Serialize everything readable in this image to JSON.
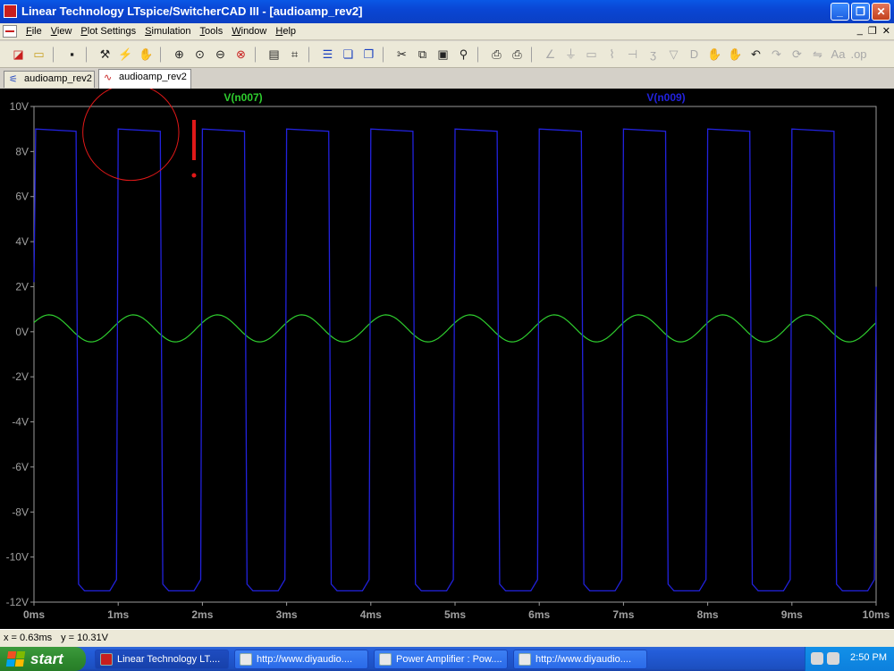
{
  "window": {
    "title": "Linear Technology LTspice/SwitcherCAD III - [audioamp_rev2]",
    "buttons": [
      "_",
      "❐",
      "✕"
    ]
  },
  "menubar": {
    "items": [
      "File",
      "View",
      "Plot Settings",
      "Simulation",
      "Tools",
      "Window",
      "Help"
    ],
    "mdi_buttons": [
      "_",
      "❐",
      "✕"
    ]
  },
  "toolbar": {
    "icons": [
      "new-schematic-icon",
      "open-icon",
      "save-icon",
      "control-panel-icon",
      "run-icon",
      "halt-icon",
      "zoom-in-icon",
      "zoom-extent-icon",
      "zoom-out-icon",
      "cancel-zoom-icon",
      "autorange-icon",
      "pick-visible-traces-icon",
      "tile-horizontal-icon",
      "cascade-icon",
      "tile-vertical-icon",
      "cut-icon",
      "copy-icon",
      "paste-icon",
      "find-icon",
      "print-setup-icon",
      "print-icon",
      "wire-icon",
      "ground-icon",
      "label-icon",
      "resistor-icon",
      "capacitor-icon",
      "inductor-icon",
      "diode-icon",
      "component-icon",
      "move-icon",
      "drag-icon",
      "undo-icon",
      "redo-icon",
      "rotate-icon",
      "mirror-icon",
      "text-icon",
      "spice-directive-icon"
    ]
  },
  "tabs": [
    {
      "label": "audioamp_rev2",
      "icon": "schematic-icon"
    },
    {
      "label": "audioamp_rev2",
      "icon": "waveform-icon"
    }
  ],
  "statusbar": {
    "x": "x = 0.63ms",
    "y": "y = 10.31V"
  },
  "taskbar": {
    "start": "start",
    "tasks": [
      "Linear Technology LT....",
      "http://www.diyaudio....",
      "Power Amplifier : Pow....",
      "http://www.diyaudio...."
    ],
    "clock": "2:50 PM"
  },
  "colors": {
    "green_trace": "#2ecc2e",
    "blue_trace": "#2222dd",
    "annotation": "#e01818"
  },
  "chart_data": {
    "type": "line",
    "xlim": [
      0,
      10
    ],
    "ylim": [
      -12,
      10
    ],
    "x_ticks": [
      "0ms",
      "1ms",
      "2ms",
      "3ms",
      "4ms",
      "5ms",
      "6ms",
      "7ms",
      "8ms",
      "9ms",
      "10ms"
    ],
    "y_ticks": [
      "10V",
      "8V",
      "6V",
      "4V",
      "2V",
      "0V",
      "-2V",
      "-4V",
      "-6V",
      "-8V",
      "-10V",
      "-12V"
    ],
    "series": [
      {
        "name": "V(n007)",
        "color": "#2ecc2e",
        "description_values": {
          "amplitude": 0.6,
          "offset": 0.15,
          "frequency_khz": 1.0,
          "phase_deg": 20
        },
        "points": [
          [
            0.0,
            0.4
          ],
          [
            0.18,
            0.75
          ],
          [
            0.43,
            0.2
          ],
          [
            0.68,
            -0.45
          ],
          [
            0.93,
            0.1
          ],
          [
            1.18,
            0.75
          ],
          [
            1.43,
            0.2
          ],
          [
            1.68,
            -0.45
          ],
          [
            1.93,
            0.1
          ],
          [
            2.18,
            0.75
          ],
          [
            2.43,
            0.2
          ],
          [
            2.68,
            -0.45
          ],
          [
            2.93,
            0.1
          ],
          [
            3.18,
            0.75
          ],
          [
            3.43,
            0.2
          ],
          [
            3.68,
            -0.45
          ],
          [
            3.93,
            0.1
          ],
          [
            4.18,
            0.75
          ],
          [
            4.43,
            0.2
          ],
          [
            4.68,
            -0.45
          ],
          [
            4.93,
            0.1
          ],
          [
            5.18,
            0.75
          ],
          [
            5.43,
            0.2
          ],
          [
            5.68,
            -0.45
          ],
          [
            5.93,
            0.1
          ],
          [
            6.18,
            0.75
          ],
          [
            6.43,
            0.2
          ],
          [
            6.68,
            -0.45
          ],
          [
            6.93,
            0.1
          ],
          [
            7.18,
            0.75
          ],
          [
            7.43,
            0.2
          ],
          [
            7.68,
            -0.45
          ],
          [
            7.93,
            0.1
          ],
          [
            8.18,
            0.75
          ],
          [
            8.43,
            0.2
          ],
          [
            8.68,
            -0.45
          ],
          [
            8.93,
            0.1
          ],
          [
            9.18,
            0.75
          ],
          [
            9.43,
            0.2
          ],
          [
            9.68,
            -0.45
          ],
          [
            9.93,
            0.1
          ],
          [
            10.0,
            0.3
          ]
        ]
      },
      {
        "name": "V(n009)",
        "color": "#2222dd",
        "points": [
          [
            0.0,
            2.2
          ],
          [
            0.02,
            9.0
          ],
          [
            0.5,
            8.9
          ],
          [
            0.53,
            -11.2
          ],
          [
            0.6,
            -11.5
          ],
          [
            0.9,
            -11.5
          ],
          [
            0.98,
            -11.0
          ],
          [
            1.0,
            9.0
          ],
          [
            1.5,
            8.9
          ],
          [
            1.53,
            -11.2
          ],
          [
            1.6,
            -11.5
          ],
          [
            1.9,
            -11.5
          ],
          [
            1.98,
            -11.0
          ],
          [
            2.0,
            9.0
          ],
          [
            2.5,
            8.9
          ],
          [
            2.53,
            -11.2
          ],
          [
            2.6,
            -11.5
          ],
          [
            2.9,
            -11.5
          ],
          [
            2.98,
            -11.0
          ],
          [
            3.0,
            9.0
          ],
          [
            3.5,
            8.9
          ],
          [
            3.53,
            -11.2
          ],
          [
            3.6,
            -11.5
          ],
          [
            3.9,
            -11.5
          ],
          [
            3.98,
            -11.0
          ],
          [
            4.0,
            9.0
          ],
          [
            4.5,
            8.9
          ],
          [
            4.53,
            -11.2
          ],
          [
            4.6,
            -11.5
          ],
          [
            4.9,
            -11.5
          ],
          [
            4.98,
            -11.0
          ],
          [
            5.0,
            9.0
          ],
          [
            5.5,
            8.9
          ],
          [
            5.53,
            -11.2
          ],
          [
            5.6,
            -11.5
          ],
          [
            5.9,
            -11.5
          ],
          [
            5.98,
            -11.0
          ],
          [
            6.0,
            9.0
          ],
          [
            6.5,
            8.9
          ],
          [
            6.53,
            -11.2
          ],
          [
            6.6,
            -11.5
          ],
          [
            6.9,
            -11.5
          ],
          [
            6.98,
            -11.0
          ],
          [
            7.0,
            9.0
          ],
          [
            7.5,
            8.9
          ],
          [
            7.53,
            -11.2
          ],
          [
            7.6,
            -11.5
          ],
          [
            7.9,
            -11.5
          ],
          [
            7.98,
            -11.0
          ],
          [
            8.0,
            9.0
          ],
          [
            8.5,
            8.9
          ],
          [
            8.53,
            -11.2
          ],
          [
            8.6,
            -11.5
          ],
          [
            8.9,
            -11.5
          ],
          [
            8.98,
            -11.0
          ],
          [
            9.0,
            9.0
          ],
          [
            9.5,
            8.9
          ],
          [
            9.53,
            -11.2
          ],
          [
            9.6,
            -11.5
          ],
          [
            9.9,
            -11.5
          ],
          [
            9.98,
            -11.0
          ],
          [
            10.0,
            2.0
          ]
        ]
      }
    ],
    "annotations": [
      {
        "type": "circle",
        "center": [
          1.15,
          8.85
        ],
        "radius_x": 0.57,
        "note": "red hand-drawn circle"
      },
      {
        "type": "exclamation",
        "x": 1.9,
        "y": 8.0,
        "text": "!"
      }
    ]
  }
}
